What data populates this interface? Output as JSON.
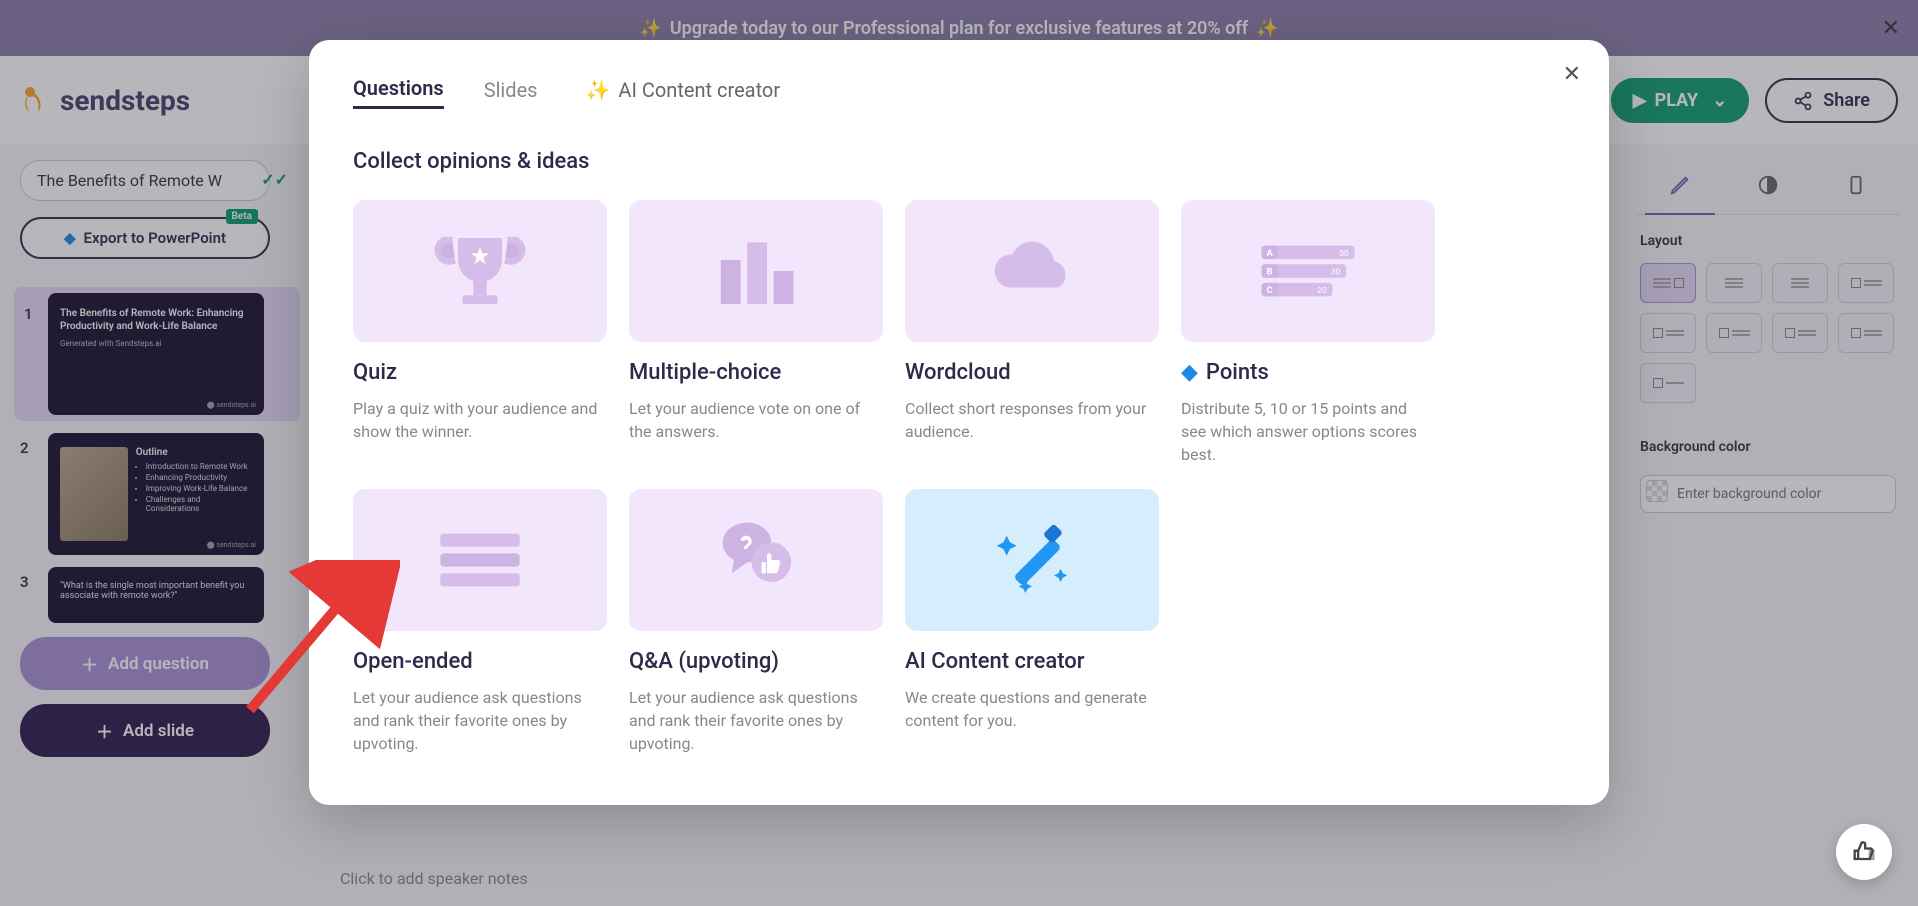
{
  "banner": {
    "text": "Upgrade today to our Professional plan for exclusive features at 20% off"
  },
  "topbar": {
    "brand": "sendsteps",
    "play": "PLAY",
    "share": "Share"
  },
  "presentation": {
    "title": "The Benefits of Remote W",
    "export_label": "Export to PowerPoint",
    "export_badge": "Beta"
  },
  "slides": [
    {
      "num": "1",
      "title": "The Benefits of Remote Work: Enhancing Productivity and Work-Life Balance",
      "sub": "Generated with Sendsteps.ai"
    },
    {
      "num": "2",
      "heading": "Outline",
      "bullets": [
        "Introduction to Remote Work",
        "Enhancing Productivity",
        "Improving Work-Life Balance",
        "Challenges and Considerations"
      ]
    },
    {
      "num": "3",
      "quote": "\"What is the single most important benefit you associate with remote work?\""
    }
  ],
  "sidebar_buttons": {
    "add_question": "Add question",
    "add_slide": "Add slide"
  },
  "right_panel": {
    "layout_label": "Layout",
    "bg_label": "Background color",
    "bg_placeholder": "Enter background color"
  },
  "notes": {
    "placeholder": "Click to add speaker notes"
  },
  "modal": {
    "tabs": {
      "questions": "Questions",
      "slides": "Slides",
      "ai": "AI Content creator"
    },
    "section_title": "Collect opinions & ideas",
    "cards": [
      {
        "title": "Quiz",
        "desc": "Play a quiz with your audience and show the winner."
      },
      {
        "title": "Multiple-choice",
        "desc": "Let your audience vote on one of the answers."
      },
      {
        "title": "Wordcloud",
        "desc": "Collect short responses from your audience."
      },
      {
        "title": "Points",
        "desc": "Distribute 5, 10 or 15 points and see which answer options scores best.",
        "diamond": true
      },
      {
        "title": "Open-ended",
        "desc": "Let your audience ask questions and rank their favorite ones by upvoting."
      },
      {
        "title": "Q&A (upvoting)",
        "desc": "Let your audience ask questions and rank their favorite ones by upvoting."
      },
      {
        "title": "AI Content creator",
        "desc": "We create questions and generate content for you.",
        "blue": true
      }
    ]
  }
}
